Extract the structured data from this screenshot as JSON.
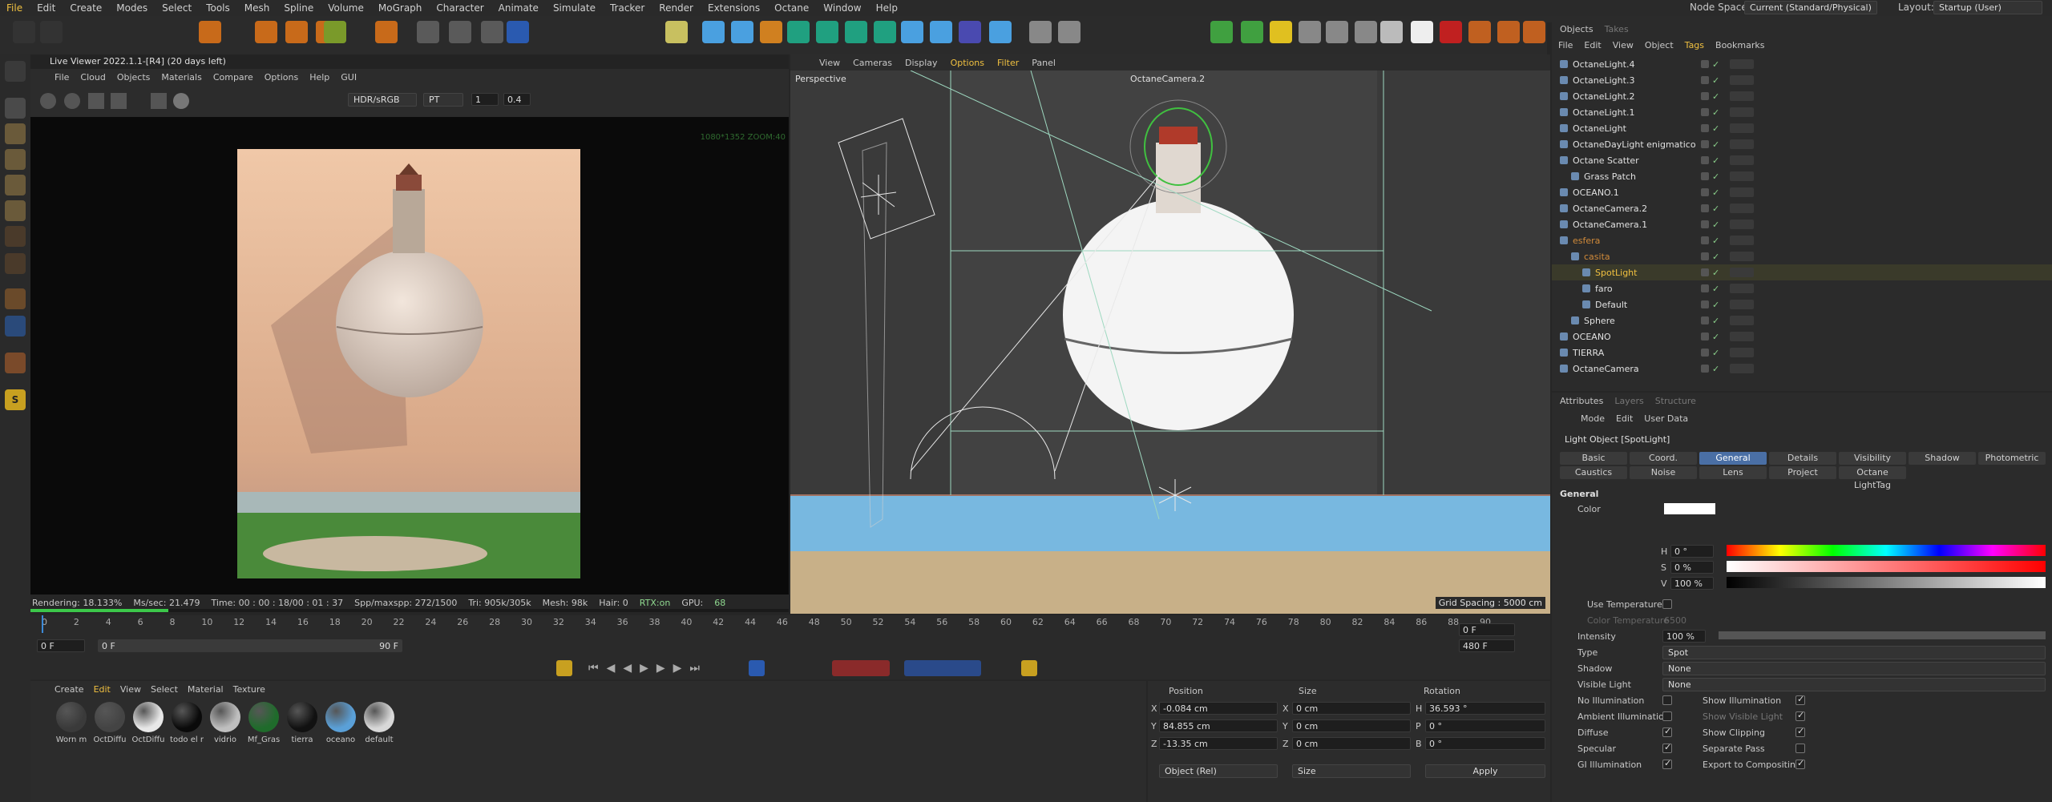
{
  "menu": [
    "File",
    "Edit",
    "Create",
    "Modes",
    "Select",
    "Tools",
    "Mesh",
    "Spline",
    "Volume",
    "MoGraph",
    "Character",
    "Animate",
    "Simulate",
    "Tracker",
    "Render",
    "Extensions",
    "Octane",
    "Window",
    "Help"
  ],
  "top_right": {
    "node_space_label": "Node Space:",
    "node_space_value": "Current (Standard/Physical)",
    "layout_label": "Layout:",
    "layout_value": "Startup (User)"
  },
  "live_viewer": {
    "title": "Live Viewer 2022.1.1-[R4] (20 days left)",
    "menu": [
      "File",
      "Cloud",
      "Objects",
      "Materials",
      "Compare",
      "Options",
      "Help",
      "GUI"
    ],
    "tonemap": "HDR/sRGB",
    "mode": "PT",
    "field1": "1",
    "field2": "0.4",
    "resolution_overlay": "1080*1352 ZOOM:40",
    "status": {
      "rendering": "Rendering: 18.133%",
      "ms_sec": "Ms/sec: 21.479",
      "time": "Time: 00 : 00 : 18/00 : 01 : 37",
      "spp": "Spp/maxspp: 272/1500",
      "tri": "Tri: 905k/305k",
      "mesh": "Mesh: 98k",
      "hair": "Hair: 0",
      "rtx": "RTX:on",
      "gpu": "GPU:",
      "gpu_val": "68"
    },
    "progress": 0.18133
  },
  "viewport": {
    "menu": [
      "View",
      "Cameras",
      "Display",
      "Options",
      "Filter",
      "Panel"
    ],
    "active_menu": "Options",
    "label": "Perspective",
    "camera_label": "OctaneCamera.2",
    "grid_spacing": "Grid Spacing : 5000 cm"
  },
  "timeline": {
    "ticks": [
      "0",
      "2",
      "4",
      "6",
      "8",
      "10",
      "12",
      "14",
      "16",
      "18",
      "20",
      "22",
      "24",
      "26",
      "28",
      "30",
      "32",
      "34",
      "36",
      "38",
      "40",
      "42",
      "44",
      "46",
      "48",
      "50",
      "52",
      "54",
      "56",
      "58",
      "60",
      "62",
      "64",
      "66",
      "68",
      "70",
      "72",
      "74",
      "76",
      "78",
      "80",
      "82",
      "84",
      "86",
      "88",
      "90"
    ],
    "start": "0 F",
    "range_start": "0 F",
    "range_end": "90 F",
    "current": "0 F",
    "end": "480 F"
  },
  "materials": {
    "menu": [
      "Create",
      "Edit",
      "View",
      "Select",
      "Material",
      "Texture"
    ],
    "items": [
      {
        "name": "Worn m",
        "color": "#3a3a3a"
      },
      {
        "name": "OctDiffu",
        "color": "#444"
      },
      {
        "name": "OctDiffu",
        "color": "#e8e8e8"
      },
      {
        "name": "todo el r",
        "color": "#0a0a0a"
      },
      {
        "name": "vidrio",
        "color": "#bfbfbf"
      },
      {
        "name": "Mf_Gras",
        "color": "#1f6b2b"
      },
      {
        "name": "tierra",
        "color": "#111"
      },
      {
        "name": "oceano",
        "color": "#5aa0d8"
      },
      {
        "name": "default",
        "color": "#d8d8d8"
      }
    ]
  },
  "coords": {
    "headers": {
      "position": "Position",
      "size": "Size",
      "rotation": "Rotation"
    },
    "rows": [
      {
        "axis": "X",
        "pos": "-0.084 cm",
        "size_axis": "X",
        "size": "0 cm",
        "rot_axis": "H",
        "rot": "36.593 °"
      },
      {
        "axis": "Y",
        "pos": "84.855 cm",
        "size_axis": "Y",
        "size": "0 cm",
        "rot_axis": "P",
        "rot": "0 °"
      },
      {
        "axis": "Z",
        "pos": "-13.35 cm",
        "size_axis": "Z",
        "size": "0 cm",
        "rot_axis": "B",
        "rot": "0 °"
      }
    ],
    "mode": "Object (Rel)",
    "size_mode": "Size",
    "apply": "Apply"
  },
  "objects": {
    "tabs": [
      "Objects",
      "Takes"
    ],
    "menu": [
      "File",
      "Edit",
      "View",
      "Object",
      "Tags",
      "Bookmarks"
    ],
    "active_menu": "Tags",
    "rows": [
      {
        "name": "OctaneLight.4",
        "color": "#e0e0e0",
        "indent": 0
      },
      {
        "name": "OctaneLight.3",
        "color": "#e0e0e0",
        "indent": 0
      },
      {
        "name": "OctaneLight.2",
        "color": "#e0e0e0",
        "indent": 0
      },
      {
        "name": "OctaneLight.1",
        "color": "#e0e0e0",
        "indent": 0
      },
      {
        "name": "OctaneLight",
        "color": "#e0e0e0",
        "indent": 0
      },
      {
        "name": "OctaneDayLight enigmatico",
        "color": "#e0e0e0",
        "indent": 0
      },
      {
        "name": "Octane Scatter",
        "color": "#e0e0e0",
        "indent": 0
      },
      {
        "name": "Grass Patch",
        "color": "#e0e0e0",
        "indent": 1
      },
      {
        "name": "OCEANO.1",
        "color": "#e0e0e0",
        "indent": 0
      },
      {
        "name": "OctaneCamera.2",
        "color": "#e0e0e0",
        "indent": 0
      },
      {
        "name": "OctaneCamera.1",
        "color": "#e0e0e0",
        "indent": 0
      },
      {
        "name": "esfera",
        "color": "#d08a3a",
        "indent": 0
      },
      {
        "name": "casita",
        "color": "#d08a3a",
        "indent": 1
      },
      {
        "name": "SpotLight",
        "color": "#f0c040",
        "indent": 2
      },
      {
        "name": "faro",
        "color": "#e0e0e0",
        "indent": 2
      },
      {
        "name": "Default",
        "color": "#e0e0e0",
        "indent": 2
      },
      {
        "name": "Sphere",
        "color": "#e0e0e0",
        "indent": 1
      },
      {
        "name": "OCEANO",
        "color": "#e0e0e0",
        "indent": 0
      },
      {
        "name": "TIERRA",
        "color": "#e0e0e0",
        "indent": 0
      },
      {
        "name": "OctaneCamera",
        "color": "#e0e0e0",
        "indent": 0
      }
    ]
  },
  "attributes": {
    "tabs": [
      "Attributes",
      "Layers",
      "Structure"
    ],
    "menu": [
      "Mode",
      "Edit",
      "User Data"
    ],
    "object_title": "Light Object [SpotLight]",
    "tab_row1": [
      "Basic",
      "Coord.",
      "General",
      "Details",
      "Visibility",
      "Shadow",
      "Photometric"
    ],
    "tab_row2": [
      "Caustics",
      "Noise",
      "Lens",
      "Project",
      "Octane LightTag"
    ],
    "active_tab": "General",
    "section": "General",
    "color_label": "Color",
    "hsv": {
      "h_label": "H",
      "h": "0 °",
      "s_label": "S",
      "s": "0 %",
      "v_label": "V",
      "v": "100 %"
    },
    "use_temperature": "Use Temperature",
    "color_temperature": "Color Temperature",
    "color_temperature_val": "6500",
    "intensity_label": "Intensity",
    "intensity": "100 %",
    "type_label": "Type",
    "type": "Spot",
    "shadow_label": "Shadow",
    "shadow": "None",
    "visible_light_label": "Visible Light",
    "visible_light": "None",
    "checks_left": [
      {
        "label": "No Illumination",
        "on": false
      },
      {
        "label": "Ambient Illumination",
        "on": false
      },
      {
        "label": "Diffuse",
        "on": true
      },
      {
        "label": "Specular",
        "on": true
      },
      {
        "label": "GI Illumination",
        "on": true
      }
    ],
    "checks_right": [
      {
        "label": "Show Illumination",
        "on": true
      },
      {
        "label": "Show Visible Light",
        "on": true
      },
      {
        "label": "Show Clipping",
        "on": true
      },
      {
        "label": "Separate Pass",
        "on": false
      },
      {
        "label": "Export to Compositing",
        "on": true
      }
    ]
  }
}
